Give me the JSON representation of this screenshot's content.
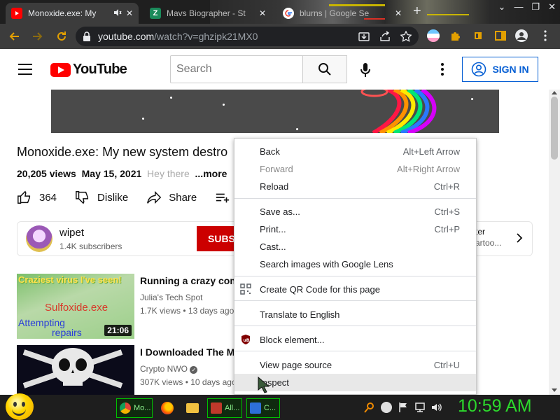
{
  "browser": {
    "tabs": [
      {
        "title": "Monoxide.exe: My",
        "active": true
      },
      {
        "title": "Mavs Biographer - St"
      },
      {
        "title": "blurns | Google Se"
      }
    ],
    "url_host": "youtube.com",
    "url_path": "/watch?v=ghzipk21MX0"
  },
  "youtube": {
    "logo_text": "YouTube",
    "search_placeholder": "Search",
    "signin_label": "SIGN IN"
  },
  "video": {
    "title": "Monoxide.exe: My new system destro",
    "views": "20,205 views",
    "date": "May 15, 2021",
    "desc_preview": "Hey there",
    "more": "...more",
    "likes": "364",
    "dislike": "Dislike",
    "share": "Share",
    "save": "Sa"
  },
  "channel": {
    "name": "wipet",
    "subs": "1.4K subscribers",
    "subscribe": "SUBS",
    "right_line1": "ter",
    "right_line2": "artoo..."
  },
  "recommendations": [
    {
      "title": "Running a crazy comp",
      "channel": "Julia's Tech Spot",
      "meta": "1.7K views • 13 days ago",
      "duration": "21:06",
      "thumb_text1": "Craziest virus I've seen!",
      "thumb_text2": "Sulfoxide.exe",
      "thumb_text3": "Attempting",
      "thumb_text4": "repairs"
    },
    {
      "title": "I Downloaded The Mo",
      "channel": "Crypto NWO",
      "meta": "307K views • 10 days ago"
    }
  ],
  "context_menu": {
    "back": {
      "label": "Back",
      "shortcut": "Alt+Left Arrow"
    },
    "forward": {
      "label": "Forward",
      "shortcut": "Alt+Right Arrow"
    },
    "reload": {
      "label": "Reload",
      "shortcut": "Ctrl+R"
    },
    "save_as": {
      "label": "Save as...",
      "shortcut": "Ctrl+S"
    },
    "print": {
      "label": "Print...",
      "shortcut": "Ctrl+P"
    },
    "cast": {
      "label": "Cast..."
    },
    "lens": {
      "label": "Search images with Google Lens"
    },
    "qr": {
      "label": "Create QR Code for this page"
    },
    "translate": {
      "label": "Translate to English"
    },
    "block": {
      "label": "Block element..."
    },
    "view_source": {
      "label": "View page source",
      "shortcut": "Ctrl+U"
    },
    "inspect": {
      "label": "Inspect"
    }
  },
  "taskbar": {
    "items": [
      "Mo...",
      "All...",
      "C..."
    ],
    "clock": "10:59 AM"
  },
  "colors": {
    "yt_red": "#ff0000",
    "link_blue": "#065fd4",
    "clock_green": "#2cd92c"
  }
}
